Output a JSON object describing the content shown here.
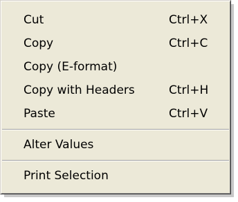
{
  "menu": {
    "items": [
      {
        "label": "Cut",
        "shortcut": "Ctrl+X"
      },
      {
        "label": "Copy",
        "shortcut": "Ctrl+C"
      },
      {
        "label": "Copy (E-format)",
        "shortcut": ""
      },
      {
        "label": "Copy with Headers",
        "shortcut": "Ctrl+H"
      },
      {
        "label": "Paste",
        "shortcut": "Ctrl+V"
      },
      {
        "label": "Alter Values",
        "shortcut": ""
      },
      {
        "label": "Print Selection",
        "shortcut": ""
      }
    ]
  }
}
